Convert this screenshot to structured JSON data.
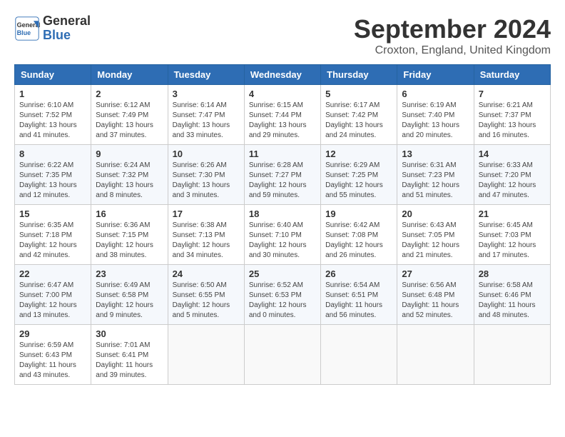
{
  "header": {
    "logo_line1": "General",
    "logo_line2": "Blue",
    "month": "September 2024",
    "location": "Croxton, England, United Kingdom"
  },
  "weekdays": [
    "Sunday",
    "Monday",
    "Tuesday",
    "Wednesday",
    "Thursday",
    "Friday",
    "Saturday"
  ],
  "weeks": [
    [
      {
        "day": "1",
        "info": "Sunrise: 6:10 AM\nSunset: 7:52 PM\nDaylight: 13 hours\nand 41 minutes."
      },
      {
        "day": "2",
        "info": "Sunrise: 6:12 AM\nSunset: 7:49 PM\nDaylight: 13 hours\nand 37 minutes."
      },
      {
        "day": "3",
        "info": "Sunrise: 6:14 AM\nSunset: 7:47 PM\nDaylight: 13 hours\nand 33 minutes."
      },
      {
        "day": "4",
        "info": "Sunrise: 6:15 AM\nSunset: 7:44 PM\nDaylight: 13 hours\nand 29 minutes."
      },
      {
        "day": "5",
        "info": "Sunrise: 6:17 AM\nSunset: 7:42 PM\nDaylight: 13 hours\nand 24 minutes."
      },
      {
        "day": "6",
        "info": "Sunrise: 6:19 AM\nSunset: 7:40 PM\nDaylight: 13 hours\nand 20 minutes."
      },
      {
        "day": "7",
        "info": "Sunrise: 6:21 AM\nSunset: 7:37 PM\nDaylight: 13 hours\nand 16 minutes."
      }
    ],
    [
      {
        "day": "8",
        "info": "Sunrise: 6:22 AM\nSunset: 7:35 PM\nDaylight: 13 hours\nand 12 minutes."
      },
      {
        "day": "9",
        "info": "Sunrise: 6:24 AM\nSunset: 7:32 PM\nDaylight: 13 hours\nand 8 minutes."
      },
      {
        "day": "10",
        "info": "Sunrise: 6:26 AM\nSunset: 7:30 PM\nDaylight: 13 hours\nand 3 minutes."
      },
      {
        "day": "11",
        "info": "Sunrise: 6:28 AM\nSunset: 7:27 PM\nDaylight: 12 hours\nand 59 minutes."
      },
      {
        "day": "12",
        "info": "Sunrise: 6:29 AM\nSunset: 7:25 PM\nDaylight: 12 hours\nand 55 minutes."
      },
      {
        "day": "13",
        "info": "Sunrise: 6:31 AM\nSunset: 7:23 PM\nDaylight: 12 hours\nand 51 minutes."
      },
      {
        "day": "14",
        "info": "Sunrise: 6:33 AM\nSunset: 7:20 PM\nDaylight: 12 hours\nand 47 minutes."
      }
    ],
    [
      {
        "day": "15",
        "info": "Sunrise: 6:35 AM\nSunset: 7:18 PM\nDaylight: 12 hours\nand 42 minutes."
      },
      {
        "day": "16",
        "info": "Sunrise: 6:36 AM\nSunset: 7:15 PM\nDaylight: 12 hours\nand 38 minutes."
      },
      {
        "day": "17",
        "info": "Sunrise: 6:38 AM\nSunset: 7:13 PM\nDaylight: 12 hours\nand 34 minutes."
      },
      {
        "day": "18",
        "info": "Sunrise: 6:40 AM\nSunset: 7:10 PM\nDaylight: 12 hours\nand 30 minutes."
      },
      {
        "day": "19",
        "info": "Sunrise: 6:42 AM\nSunset: 7:08 PM\nDaylight: 12 hours\nand 26 minutes."
      },
      {
        "day": "20",
        "info": "Sunrise: 6:43 AM\nSunset: 7:05 PM\nDaylight: 12 hours\nand 21 minutes."
      },
      {
        "day": "21",
        "info": "Sunrise: 6:45 AM\nSunset: 7:03 PM\nDaylight: 12 hours\nand 17 minutes."
      }
    ],
    [
      {
        "day": "22",
        "info": "Sunrise: 6:47 AM\nSunset: 7:00 PM\nDaylight: 12 hours\nand 13 minutes."
      },
      {
        "day": "23",
        "info": "Sunrise: 6:49 AM\nSunset: 6:58 PM\nDaylight: 12 hours\nand 9 minutes."
      },
      {
        "day": "24",
        "info": "Sunrise: 6:50 AM\nSunset: 6:55 PM\nDaylight: 12 hours\nand 5 minutes."
      },
      {
        "day": "25",
        "info": "Sunrise: 6:52 AM\nSunset: 6:53 PM\nDaylight: 12 hours\nand 0 minutes."
      },
      {
        "day": "26",
        "info": "Sunrise: 6:54 AM\nSunset: 6:51 PM\nDaylight: 11 hours\nand 56 minutes."
      },
      {
        "day": "27",
        "info": "Sunrise: 6:56 AM\nSunset: 6:48 PM\nDaylight: 11 hours\nand 52 minutes."
      },
      {
        "day": "28",
        "info": "Sunrise: 6:58 AM\nSunset: 6:46 PM\nDaylight: 11 hours\nand 48 minutes."
      }
    ],
    [
      {
        "day": "29",
        "info": "Sunrise: 6:59 AM\nSunset: 6:43 PM\nDaylight: 11 hours\nand 43 minutes."
      },
      {
        "day": "30",
        "info": "Sunrise: 7:01 AM\nSunset: 6:41 PM\nDaylight: 11 hours\nand 39 minutes."
      },
      {
        "day": "",
        "info": ""
      },
      {
        "day": "",
        "info": ""
      },
      {
        "day": "",
        "info": ""
      },
      {
        "day": "",
        "info": ""
      },
      {
        "day": "",
        "info": ""
      }
    ]
  ]
}
